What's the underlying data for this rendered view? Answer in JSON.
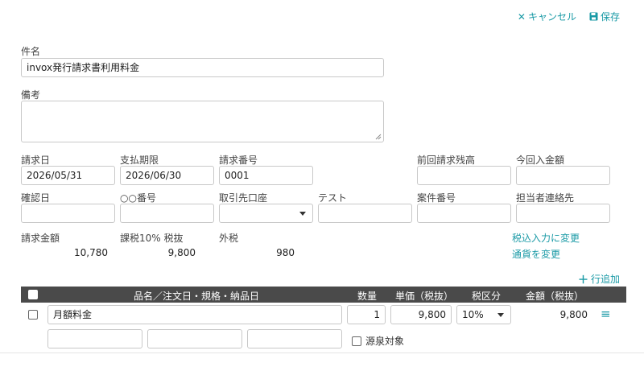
{
  "toolbar": {
    "cancel_label": "キャンセル",
    "save_label": "保存",
    "cancel_icon": "close-icon",
    "save_icon": "floppy-icon"
  },
  "subject": {
    "label": "件名",
    "value": "invox発行請求書利用料金"
  },
  "remarks": {
    "label": "備考",
    "value": ""
  },
  "fields_row1": {
    "invoice_date_label": "請求日",
    "invoice_date": "2026/05/31",
    "due_date_label": "支払期限",
    "due_date": "2026/06/30",
    "invoice_no_label": "請求番号",
    "invoice_no": "0001",
    "prev_balance_label": "前回請求残高",
    "prev_balance": "",
    "received_label": "今回入金額",
    "received": ""
  },
  "fields_row2": {
    "confirm_date_label": "確認日",
    "confirm_date": "",
    "oo_number_label": "○○番号",
    "oo_number": "",
    "bank_label": "取引先口座",
    "bank": "",
    "test_label": "テスト",
    "test": "",
    "case_no_label": "案件番号",
    "case_no": "",
    "contact_label": "担当者連絡先",
    "contact": ""
  },
  "totals": {
    "amount_label": "請求金額",
    "amount": "10,780",
    "taxable_label": "課税10% 税抜",
    "taxable": "9,800",
    "tax_label": "外税",
    "tax": "980",
    "switch_tax_label": "税込入力に変更",
    "change_currency_label": "通貨を変更"
  },
  "add_row_label": "行追加",
  "table": {
    "headers": {
      "item": "品名／注文日・規格・納品日",
      "qty": "数量",
      "unit_price": "単価（税抜）",
      "tax_class": "税区分",
      "amount": "金額（税抜）"
    },
    "rows": [
      {
        "item": "月額料金",
        "qty": "1",
        "unit_price": "9,800",
        "tax_class": "10%",
        "amount": "9,800",
        "withholding_label": "源泉対象"
      }
    ]
  }
}
